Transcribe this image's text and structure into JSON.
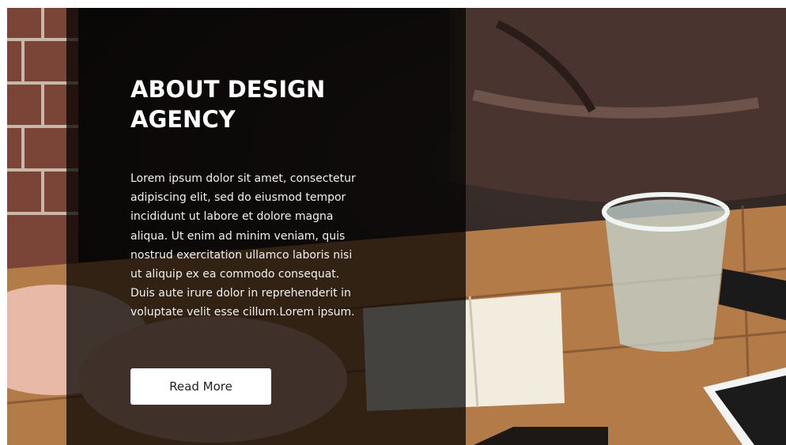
{
  "hero": {
    "title": "ABOUT DESIGN\nAGENCY",
    "body": "Lorem ipsum dolor sit amet, consectetur\nadipiscing elit, sed do eiusmod tempor\nincididunt ut labore et dolore magna\naliqua. Ut enim ad minim veniam, quis\nnostrud exercitation ullamco laboris nisi\nut aliquip ex ea commodo consequat.\nDuis aute irure dolor in reprehenderit in\nvoluptate velit esse cillum.Lorem ipsum.",
    "button_label": "Read More"
  },
  "colors": {
    "overlay": "#000000",
    "title": "#ffffff",
    "button_bg": "#ffffff",
    "button_text": "#222222"
  }
}
